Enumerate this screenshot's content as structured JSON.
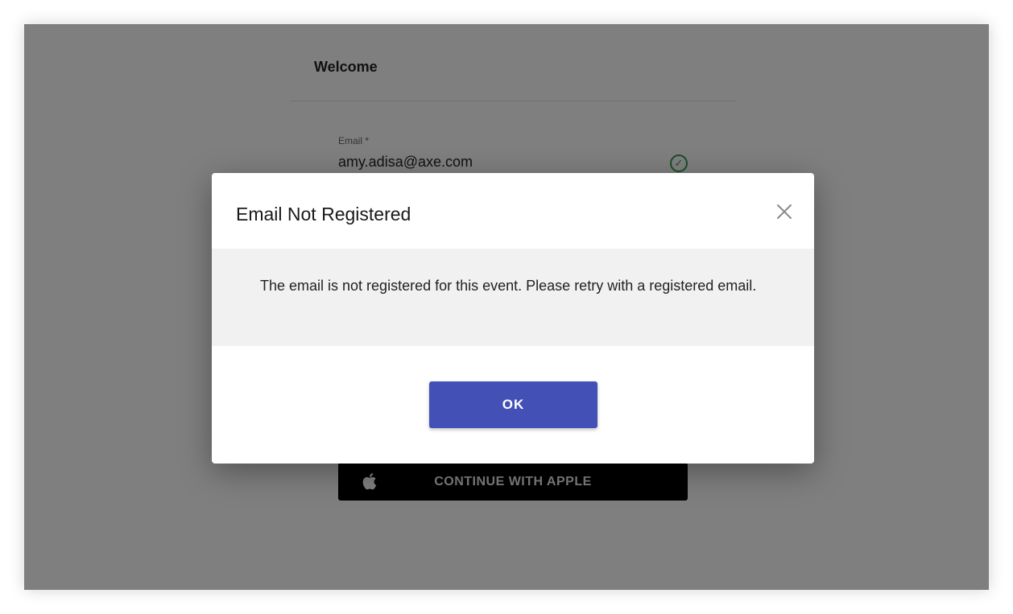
{
  "card": {
    "title": "Welcome",
    "email_label": "Email *",
    "email_value": "amy.adisa@axe.com",
    "apple_button_label": "CONTINUE WITH APPLE"
  },
  "dialog": {
    "title": "Email Not Registered",
    "message": "The email is not registered for this event. Please retry with a registered email.",
    "ok_label": "OK"
  },
  "colors": {
    "primary": "#4350b5",
    "success": "#2e9e4a",
    "overlay": "rgba(0,0,0,0.5)"
  },
  "icons": {
    "close": "close-icon",
    "valid": "check-circle-icon",
    "apple": "apple-icon"
  }
}
